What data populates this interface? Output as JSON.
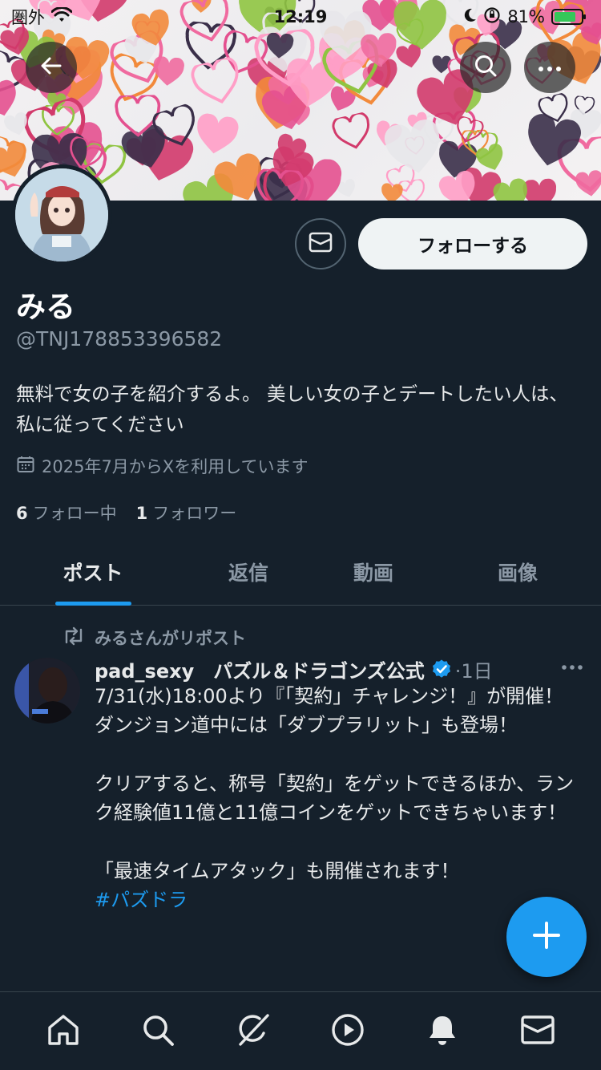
{
  "status_bar": {
    "carrier": "圏外",
    "time": "12:19",
    "battery_percent": "81%"
  },
  "profile": {
    "display_name": "みる",
    "handle": "@TNJ178853396582",
    "bio": "無料で女の子を紹介するよ。 美しい女の子とデートしたい人は、私に従ってください",
    "joined": "2025年7月からXを利用しています",
    "following_count": "6",
    "following_label": "フォロー中",
    "followers_count": "1",
    "followers_label": "フォロワー",
    "follow_button_label": "フォローする"
  },
  "tabs": [
    {
      "label": "ポスト",
      "active": true
    },
    {
      "label": "返信",
      "active": false
    },
    {
      "label": "動画",
      "active": false
    },
    {
      "label": "画像",
      "active": false
    }
  ],
  "post": {
    "repost_label": "みるさんがリポスト",
    "username": "pad_sexy　パズル＆ドラゴンズ公式",
    "time": "·1日",
    "body": "7/31(水)18:00より『「契約」チャレンジ！』が開催！\nダンジョン道中には「ダブプラリット」も登場！\n\nクリアすると、称号「契約」をゲットできるほか、ランク経験値11億と11億コインをゲットできちゃいます！\n\n「最速タイムアタック」も開催されます！\n",
    "hashtag": "#パズドラ"
  },
  "colors": {
    "background": "#15202b",
    "accent": "#1d9bf0",
    "muted": "#8b98a5",
    "divider": "#38444d"
  },
  "icons": {
    "back": "arrow-left-icon",
    "search": "search-icon",
    "more": "more-icon",
    "message": "envelope-icon",
    "calendar": "calendar-icon",
    "repost": "repost-icon",
    "verified": "verified-badge-icon",
    "fab": "plus-icon",
    "nav": [
      "home-icon",
      "search-icon",
      "grok-icon",
      "play-icon",
      "bell-icon",
      "mail-icon"
    ]
  }
}
